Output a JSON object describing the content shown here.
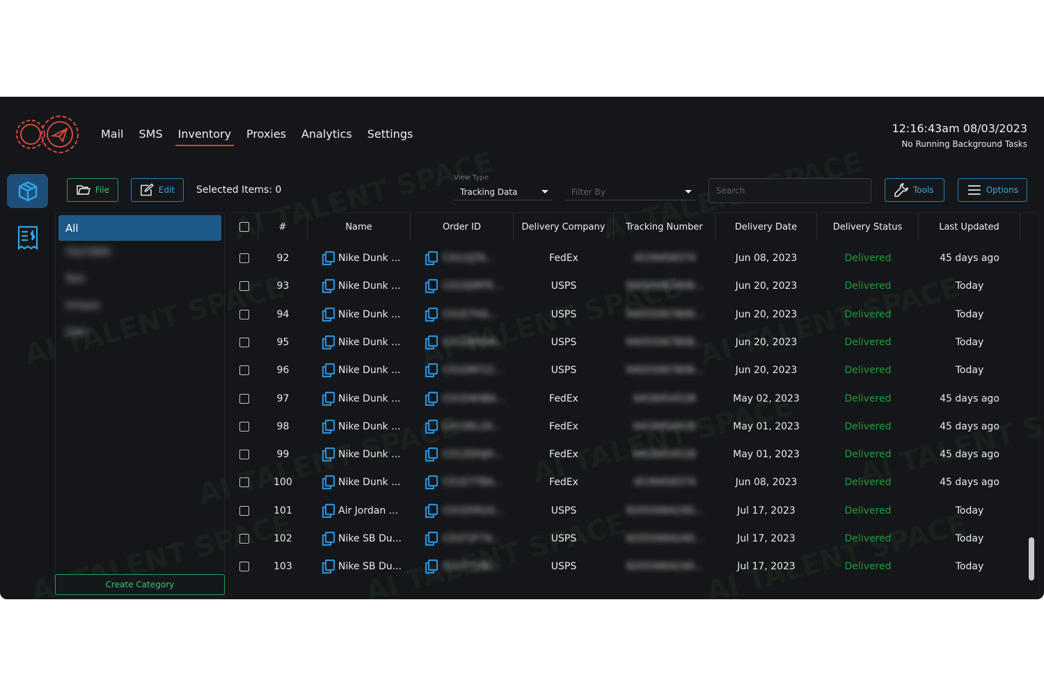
{
  "header": {
    "nav": [
      {
        "label": "Mail",
        "active": false
      },
      {
        "label": "SMS",
        "active": false
      },
      {
        "label": "Inventory",
        "active": true
      },
      {
        "label": "Proxies",
        "active": false
      },
      {
        "label": "Analytics",
        "active": false
      },
      {
        "label": "Settings",
        "active": false
      }
    ],
    "clock": "12:16:43am 08/03/2023",
    "background_status": "No Running Background Tasks"
  },
  "rail": {
    "items": [
      {
        "icon": "box-icon",
        "active": true
      },
      {
        "icon": "receipt-dollar-icon",
        "active": false
      }
    ]
  },
  "toolbar": {
    "file_label": "File",
    "edit_label": "Edit",
    "selected_items": "Selected Items: 0",
    "view_type_label": "View Type",
    "view_type_value": "Tracking Data",
    "filter_placeholder": "Filter By",
    "search_placeholder": "Search",
    "tools_label": "Tools",
    "options_label": "Options"
  },
  "categories": {
    "items": [
      "All",
      "TQ37899",
      "Test",
      "Unique",
      "User"
    ],
    "create_label": "Create Category"
  },
  "table": {
    "columns": [
      "#",
      "Name",
      "Order ID",
      "Delivery Company",
      "Tracking Number",
      "Delivery Date",
      "Delivery Status",
      "Last Updated"
    ],
    "rows": [
      {
        "num": "92",
        "name": "Nike Dunk ...",
        "order_id": "C01I2JTA...",
        "company": "FedEx",
        "tracking": "4539458374",
        "date": "Jun 08, 2023",
        "status": "Delivered",
        "updated": "45 days ago"
      },
      {
        "num": "93",
        "name": "Nike Dunk ...",
        "order_id": "C01SDRTE...",
        "company": "USPS",
        "tracking": "94055067808...",
        "date": "Jun 20, 2023",
        "status": "Delivered",
        "updated": "Today"
      },
      {
        "num": "94",
        "name": "Nike Dunk ...",
        "order_id": "C01E7HA...",
        "company": "USPS",
        "tracking": "94055067808...",
        "date": "Jun 20, 2023",
        "status": "Delivered",
        "updated": "Today"
      },
      {
        "num": "95",
        "name": "Nike Dunk ...",
        "order_id": "C01DERHA...",
        "company": "USPS",
        "tracking": "94055067808...",
        "date": "Jun 20, 2023",
        "status": "Delivered",
        "updated": "Today"
      },
      {
        "num": "96",
        "name": "Nike Dunk ...",
        "order_id": "C01DRF22...",
        "company": "USPS",
        "tracking": "94055067808...",
        "date": "Jun 20, 2023",
        "status": "Delivered",
        "updated": "Today"
      },
      {
        "num": "97",
        "name": "Nike Dunk ...",
        "order_id": "C01D4HBA...",
        "company": "FedEx",
        "tracking": "6418454528",
        "date": "May 02, 2023",
        "status": "Delivered",
        "updated": "45 days ago"
      },
      {
        "num": "98",
        "name": "Nike Dunk ...",
        "order_id": "C01SKL20...",
        "company": "FedEx",
        "tracking": "6418454528",
        "date": "May 01, 2023",
        "status": "Delivered",
        "updated": "45 days ago"
      },
      {
        "num": "99",
        "name": "Nike Dunk ...",
        "order_id": "C01ZDHJH...",
        "company": "FedEx",
        "tracking": "6418454528",
        "date": "May 01, 2023",
        "status": "Delivered",
        "updated": "45 days ago"
      },
      {
        "num": "100",
        "name": "Nike Dunk ...",
        "order_id": "C01E7TBA...",
        "company": "FedEx",
        "tracking": "4539458374",
        "date": "Jun 08, 2023",
        "status": "Delivered",
        "updated": "45 days ago"
      },
      {
        "num": "101",
        "name": "Air Jordan ...",
        "order_id": "C01D5R24...",
        "company": "USPS",
        "tracking": "92055664240...",
        "date": "Jul 17, 2023",
        "status": "Delivered",
        "updated": "Today"
      },
      {
        "num": "102",
        "name": "Nike SB Du...",
        "order_id": "C01F2F74...",
        "company": "USPS",
        "tracking": "92055664240...",
        "date": "Jul 17, 2023",
        "status": "Delivered",
        "updated": "Today"
      },
      {
        "num": "103",
        "name": "Nike SB Du...",
        "order_id": "C01F7285...",
        "company": "USPS",
        "tracking": "92055664240...",
        "date": "Jul 17, 2023",
        "status": "Delivered",
        "updated": "Today"
      }
    ]
  },
  "watermark": "AI TALENT SPACE",
  "colors": {
    "accent_red": "#e0443a",
    "green": "#2f9b58",
    "blue": "#2f7fb0",
    "delivered": "#1f9d3e",
    "active_tab": "#1e5a88"
  }
}
